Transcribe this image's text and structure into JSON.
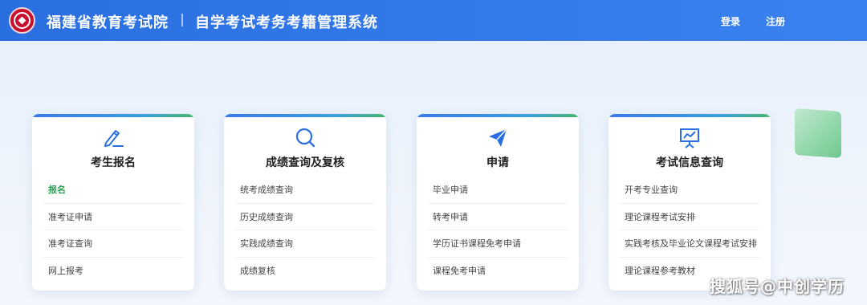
{
  "header": {
    "org_name": "福建省教育考试院",
    "system_name": "自学考试考务考籍管理系统",
    "login_label": "登录",
    "register_label": "注册"
  },
  "colors": {
    "header_blue": "#2a6fe0",
    "accent_green": "#2f9e55",
    "icon_blue": "#2a6fe0"
  },
  "cards": [
    {
      "title": "考生报名",
      "icon": "pencil-icon",
      "items": [
        {
          "label": "报名",
          "active": true
        },
        {
          "label": "准考证申请",
          "active": false
        },
        {
          "label": "准考证查询",
          "active": false
        },
        {
          "label": "网上报考",
          "active": false
        }
      ]
    },
    {
      "title": "成绩查询及复核",
      "icon": "search-icon",
      "items": [
        {
          "label": "统考成绩查询",
          "active": false
        },
        {
          "label": "历史成绩查询",
          "active": false
        },
        {
          "label": "实践成绩查询",
          "active": false
        },
        {
          "label": "成绩复核",
          "active": false
        }
      ]
    },
    {
      "title": "申请",
      "icon": "paper-plane-icon",
      "items": [
        {
          "label": "毕业申请",
          "active": false
        },
        {
          "label": "转考申请",
          "active": false
        },
        {
          "label": "学历证书课程免考申请",
          "active": false
        },
        {
          "label": "课程免考申请",
          "active": false
        }
      ]
    },
    {
      "title": "考试信息查询",
      "icon": "presentation-chart-icon",
      "items": [
        {
          "label": "开考专业查询",
          "active": false
        },
        {
          "label": "理论课程考试安排",
          "active": false
        },
        {
          "label": "实践考核及毕业论文课程考试安排",
          "active": false
        },
        {
          "label": "理论课程参考教材",
          "active": false
        }
      ]
    }
  ],
  "watermark": "搜狐号@中创学历"
}
